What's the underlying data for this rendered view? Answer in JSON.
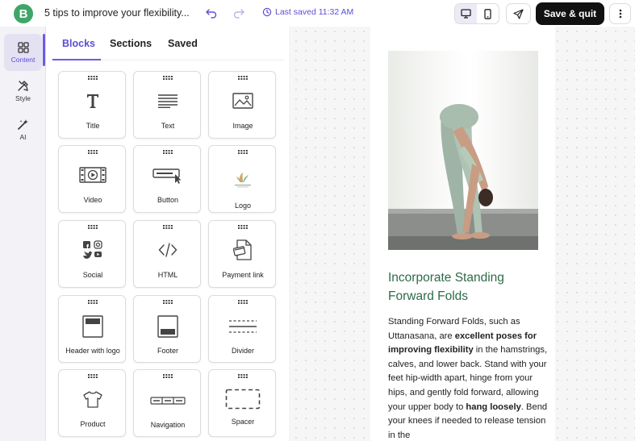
{
  "app": {
    "logo_letter": "B"
  },
  "header": {
    "doc_title": "5 tips to improve your flexibility...",
    "saved_status": "Last saved 11:32 AM",
    "save_quit_label": "Save & quit"
  },
  "rail": {
    "items": [
      {
        "label": "Content",
        "icon": "grid-icon"
      },
      {
        "label": "Style",
        "icon": "style-icon"
      },
      {
        "label": "AI",
        "icon": "magic-wand-icon"
      }
    ]
  },
  "panel": {
    "tabs": [
      "Blocks",
      "Sections",
      "Saved"
    ],
    "blocks": [
      {
        "label": "Title",
        "icon": "title-icon"
      },
      {
        "label": "Text",
        "icon": "text-icon"
      },
      {
        "label": "Image",
        "icon": "image-icon"
      },
      {
        "label": "Video",
        "icon": "video-icon"
      },
      {
        "label": "Button",
        "icon": "button-icon"
      },
      {
        "label": "Logo",
        "icon": "logo-icon"
      },
      {
        "label": "Social",
        "icon": "social-icon"
      },
      {
        "label": "HTML",
        "icon": "code-icon"
      },
      {
        "label": "Payment link",
        "icon": "payment-link-icon"
      },
      {
        "label": "Header with logo",
        "icon": "header-icon"
      },
      {
        "label": "Footer",
        "icon": "footer-icon"
      },
      {
        "label": "Divider",
        "icon": "divider-icon"
      },
      {
        "label": "Product",
        "icon": "product-icon"
      },
      {
        "label": "Navigation",
        "icon": "navigation-icon"
      },
      {
        "label": "Spacer",
        "icon": "spacer-icon"
      }
    ]
  },
  "canvas": {
    "heading": "Incorporate Standing Forward Folds",
    "body": {
      "p1": "Standing Forward Folds, such as Uttanasana, are ",
      "b1": "excellent poses for improving flexibility",
      "p2": " in the hamstrings, calves, and lower back. Stand with your feet hip-width apart, hinge from your hips, and gently fold forward, allowing your upper body to ",
      "b2": "hang loosely",
      "p3": ". Bend your knees if needed to release tension in the"
    }
  },
  "colors": {
    "accent": "#6b5be6",
    "brand_green": "#3fa66a",
    "heading_green": "#2e6b48"
  }
}
